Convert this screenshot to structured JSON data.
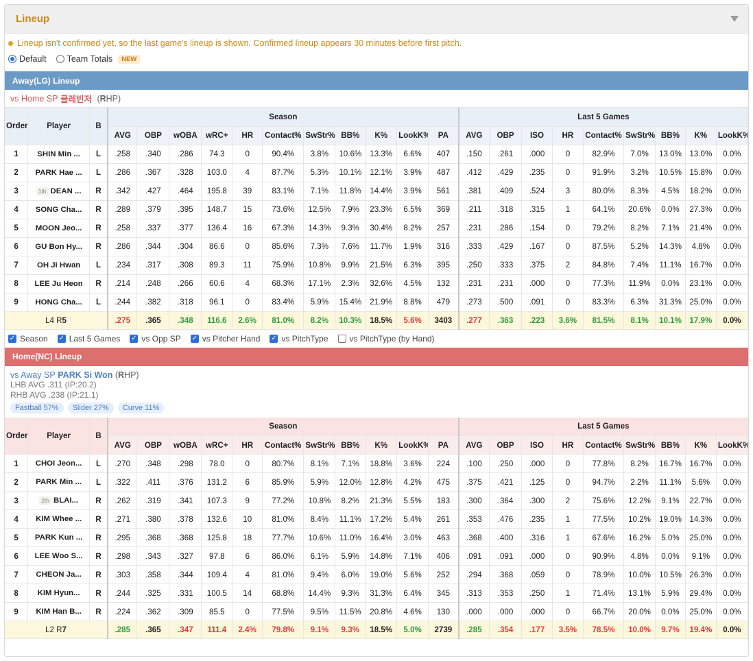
{
  "panel": {
    "title": "Lineup",
    "notice": "Lineup isn't confirmed yet, so the last game's lineup is shown. Confirmed lineup appears 30 minutes before first pitch.",
    "view_options": [
      {
        "label": "Default",
        "selected": true
      },
      {
        "label": "Team Totals",
        "selected": false,
        "badge": "NEW"
      }
    ]
  },
  "columns": {
    "order": "Order",
    "player": "Player",
    "bats": "B",
    "season_group": "Season",
    "last5_group": "Last 5 Games",
    "season": [
      "AVG",
      "OBP",
      "wOBA",
      "wRC+",
      "HR",
      "Contact%",
      "SwStr%",
      "BB%",
      "K%",
      "LookK%",
      "PA"
    ],
    "last5": [
      "AVG",
      "OBP",
      "ISO",
      "HR",
      "Contact%",
      "SwStr%",
      "BB%",
      "K%",
      "LookK%"
    ]
  },
  "away": {
    "bar": "Away(LG) Lineup",
    "vs_prefix": "vs Home SP",
    "sp_name": "클레빈저",
    "hand_open": "(",
    "hand_letter": "R",
    "hand_rest": "HP)",
    "players": [
      {
        "order": "1",
        "name": "SHIN Min ...",
        "tag": "",
        "bats": "L",
        "season": [
          ".258",
          ".340",
          ".286",
          "74.3",
          "0",
          "90.4%",
          "3.8%",
          "10.6%",
          "13.3%",
          "6.6%",
          "407"
        ],
        "last5": [
          ".150",
          ".261",
          ".000",
          "0",
          "82.9%",
          "7.0%",
          "13.0%",
          "13.0%",
          "0.0%"
        ]
      },
      {
        "order": "2",
        "name": "PARK Hae ...",
        "tag": "",
        "bats": "L",
        "season": [
          ".286",
          ".367",
          ".328",
          "103.0",
          "4",
          "87.7%",
          "5.3%",
          "10.1%",
          "12.1%",
          "3.9%",
          "487"
        ],
        "last5": [
          ".412",
          ".429",
          ".235",
          "0",
          "91.9%",
          "3.2%",
          "10.5%",
          "15.8%",
          "0.0%"
        ]
      },
      {
        "order": "3",
        "name": "DEAN ...",
        "tag": "1th",
        "bats": "R",
        "season": [
          ".342",
          ".427",
          ".464",
          "195.8",
          "39",
          "83.1%",
          "7.1%",
          "11.8%",
          "14.4%",
          "3.9%",
          "561"
        ],
        "last5": [
          ".381",
          ".409",
          ".524",
          "3",
          "80.0%",
          "8.3%",
          "4.5%",
          "18.2%",
          "0.0%"
        ]
      },
      {
        "order": "4",
        "name": "SONG Cha...",
        "tag": "",
        "bats": "R",
        "season": [
          ".289",
          ".379",
          ".395",
          "148.7",
          "15",
          "73.6%",
          "12.5%",
          "7.9%",
          "23.3%",
          "6.5%",
          "369"
        ],
        "last5": [
          ".211",
          ".318",
          ".315",
          "1",
          "64.1%",
          "20.6%",
          "0.0%",
          "27.3%",
          "0.0%"
        ]
      },
      {
        "order": "5",
        "name": "MOON Jeo...",
        "tag": "",
        "bats": "R",
        "season": [
          ".258",
          ".337",
          ".377",
          "136.4",
          "16",
          "67.3%",
          "14.3%",
          "9.3%",
          "30.4%",
          "8.2%",
          "257"
        ],
        "last5": [
          ".231",
          ".286",
          ".154",
          "0",
          "79.2%",
          "8.2%",
          "7.1%",
          "21.4%",
          "0.0%"
        ]
      },
      {
        "order": "6",
        "name": "GU Bon Hy...",
        "tag": "",
        "bats": "R",
        "season": [
          ".286",
          ".344",
          ".304",
          "86.6",
          "0",
          "85.6%",
          "7.3%",
          "7.6%",
          "11.7%",
          "1.9%",
          "316"
        ],
        "last5": [
          ".333",
          ".429",
          ".167",
          "0",
          "87.5%",
          "5.2%",
          "14.3%",
          "4.8%",
          "0.0%"
        ]
      },
      {
        "order": "7",
        "name": "OH Ji Hwan",
        "tag": "",
        "bats": "L",
        "season": [
          ".234",
          ".317",
          ".308",
          "89.3",
          "11",
          "75.9%",
          "10.8%",
          "9.9%",
          "21.5%",
          "6.3%",
          "395"
        ],
        "last5": [
          ".250",
          ".333",
          ".375",
          "2",
          "84.8%",
          "7.4%",
          "11.1%",
          "16.7%",
          "0.0%"
        ]
      },
      {
        "order": "8",
        "name": "LEE Ju Heon",
        "tag": "",
        "bats": "R",
        "season": [
          ".214",
          ".248",
          ".266",
          "60.6",
          "4",
          "68.3%",
          "17.1%",
          "2.3%",
          "32.6%",
          "4.5%",
          "132"
        ],
        "last5": [
          ".231",
          ".231",
          ".000",
          "0",
          "77.3%",
          "11.9%",
          "0.0%",
          "23.1%",
          "0.0%"
        ]
      },
      {
        "order": "9",
        "name": "HONG Cha...",
        "tag": "",
        "bats": "L",
        "season": [
          ".244",
          ".382",
          ".318",
          "96.1",
          "0",
          "83.4%",
          "5.9%",
          "15.4%",
          "21.9%",
          "8.8%",
          "479"
        ],
        "last5": [
          ".273",
          ".500",
          ".091",
          "0",
          "83.3%",
          "6.3%",
          "31.3%",
          "25.0%",
          "0.0%"
        ]
      }
    ],
    "totals": {
      "label_l": "L4 R",
      "label_r": "5",
      "season": [
        ".275",
        ".365",
        ".348",
        "116.6",
        "2.6%",
        "81.0%",
        "8.2%",
        "10.3%",
        "18.5%",
        "5.6%",
        "3403"
      ],
      "season_colors": [
        "r",
        "k",
        "g",
        "g",
        "g",
        "g",
        "g",
        "g",
        "k",
        "r",
        "k"
      ],
      "last5": [
        ".277",
        ".363",
        ".223",
        "3.6%",
        "81.5%",
        "8.1%",
        "10.1%",
        "17.9%",
        "0.0%"
      ],
      "last5_colors": [
        "r",
        "g",
        "g",
        "g",
        "g",
        "g",
        "g",
        "g",
        "k"
      ]
    }
  },
  "filters": [
    {
      "label": "Season",
      "checked": true
    },
    {
      "label": "Last 5 Games",
      "checked": true
    },
    {
      "label": "vs Opp SP",
      "checked": true
    },
    {
      "label": "vs Pitcher Hand",
      "checked": true
    },
    {
      "label": "vs PitchType",
      "checked": true
    },
    {
      "label": "vs PitchType (by Hand)",
      "checked": false
    }
  ],
  "home": {
    "bar": "Home(NC) Lineup",
    "vs_prefix": "vs Away SP",
    "sp_name": "PARK Si Won",
    "hand_open": "(",
    "hand_letter": "R",
    "hand_rest": "HP)",
    "lhb_avg": "LHB AVG .311 (IP:20.2)",
    "rhb_avg": "RHB AVG .238 (IP:21.1)",
    "pitch_mix": [
      "Fastball 57%",
      "Slider 27%",
      "Curve 11%"
    ],
    "players": [
      {
        "order": "1",
        "name": "CHOI Jeon...",
        "tag": "",
        "bats": "L",
        "season": [
          ".270",
          ".348",
          ".298",
          "78.0",
          "0",
          "80.7%",
          "8.1%",
          "7.1%",
          "18.8%",
          "3.6%",
          "224"
        ],
        "last5": [
          ".100",
          ".250",
          ".000",
          "0",
          "77.8%",
          "8.2%",
          "16.7%",
          "16.7%",
          "0.0%"
        ]
      },
      {
        "order": "2",
        "name": "PARK Min ...",
        "tag": "",
        "bats": "L",
        "season": [
          ".322",
          ".411",
          ".376",
          "131.2",
          "6",
          "85.9%",
          "5.9%",
          "12.0%",
          "12.8%",
          "4.2%",
          "475"
        ],
        "last5": [
          ".375",
          ".421",
          ".125",
          "0",
          "94.7%",
          "2.2%",
          "11.1%",
          "5.6%",
          "0.0%"
        ]
      },
      {
        "order": "3",
        "name": "BLAI...",
        "tag": "2th",
        "bats": "R",
        "season": [
          ".262",
          ".319",
          ".341",
          "107.3",
          "9",
          "77.2%",
          "10.8%",
          "8.2%",
          "21.3%",
          "5.5%",
          "183"
        ],
        "last5": [
          ".300",
          ".364",
          ".300",
          "2",
          "75.6%",
          "12.2%",
          "9.1%",
          "22.7%",
          "0.0%"
        ]
      },
      {
        "order": "4",
        "name": "KIM Whee ...",
        "tag": "",
        "bats": "R",
        "season": [
          ".271",
          ".380",
          ".378",
          "132.6",
          "10",
          "81.0%",
          "8.4%",
          "11.1%",
          "17.2%",
          "5.4%",
          "261"
        ],
        "last5": [
          ".353",
          ".476",
          ".235",
          "1",
          "77.5%",
          "10.2%",
          "19.0%",
          "14.3%",
          "0.0%"
        ]
      },
      {
        "order": "5",
        "name": "PARK Kun ...",
        "tag": "",
        "bats": "R",
        "season": [
          ".295",
          ".368",
          ".368",
          "125.8",
          "18",
          "77.7%",
          "10.6%",
          "11.0%",
          "16.4%",
          "3.0%",
          "463"
        ],
        "last5": [
          ".368",
          ".400",
          ".316",
          "1",
          "67.6%",
          "16.2%",
          "5.0%",
          "25.0%",
          "0.0%"
        ]
      },
      {
        "order": "6",
        "name": "LEE Woo S...",
        "tag": "",
        "bats": "R",
        "season": [
          ".298",
          ".343",
          ".327",
          "97.8",
          "6",
          "86.0%",
          "6.1%",
          "5.9%",
          "14.8%",
          "7.1%",
          "406"
        ],
        "last5": [
          ".091",
          ".091",
          ".000",
          "0",
          "90.9%",
          "4.8%",
          "0.0%",
          "9.1%",
          "0.0%"
        ]
      },
      {
        "order": "7",
        "name": "CHEON Ja...",
        "tag": "",
        "bats": "R",
        "season": [
          ".303",
          ".358",
          ".344",
          "109.4",
          "4",
          "81.0%",
          "9.4%",
          "6.0%",
          "19.0%",
          "5.6%",
          "252"
        ],
        "last5": [
          ".294",
          ".368",
          ".059",
          "0",
          "78.9%",
          "10.0%",
          "10.5%",
          "26.3%",
          "0.0%"
        ]
      },
      {
        "order": "8",
        "name": "KIM Hyun...",
        "tag": "",
        "bats": "R",
        "season": [
          ".244",
          ".325",
          ".331",
          "100.5",
          "14",
          "68.8%",
          "14.4%",
          "9.3%",
          "31.3%",
          "6.4%",
          "345"
        ],
        "last5": [
          ".313",
          ".353",
          ".250",
          "1",
          "71.4%",
          "13.1%",
          "5.9%",
          "29.4%",
          "0.0%"
        ]
      },
      {
        "order": "9",
        "name": "KIM Han B...",
        "tag": "",
        "bats": "R",
        "season": [
          ".224",
          ".362",
          ".309",
          "85.5",
          "0",
          "77.5%",
          "9.5%",
          "11.5%",
          "20.8%",
          "4.6%",
          "130"
        ],
        "last5": [
          ".000",
          ".000",
          ".000",
          "0",
          "66.7%",
          "20.0%",
          "0.0%",
          "25.0%",
          "0.0%"
        ]
      }
    ],
    "totals": {
      "label_l": "L2 R",
      "label_r": "7",
      "season": [
        ".285",
        ".365",
        ".347",
        "111.4",
        "2.4%",
        "79.8%",
        "9.1%",
        "9.3%",
        "18.5%",
        "5.0%",
        "2739"
      ],
      "season_colors": [
        "g",
        "k",
        "r",
        "r",
        "r",
        "r",
        "r",
        "r",
        "k",
        "g",
        "k"
      ],
      "last5": [
        ".285",
        ".354",
        ".177",
        "3.5%",
        "78.5%",
        "10.0%",
        "9.7%",
        "19.4%",
        "0.0%"
      ],
      "last5_colors": [
        "g",
        "r",
        "r",
        "r",
        "r",
        "r",
        "r",
        "r",
        "k"
      ]
    }
  }
}
